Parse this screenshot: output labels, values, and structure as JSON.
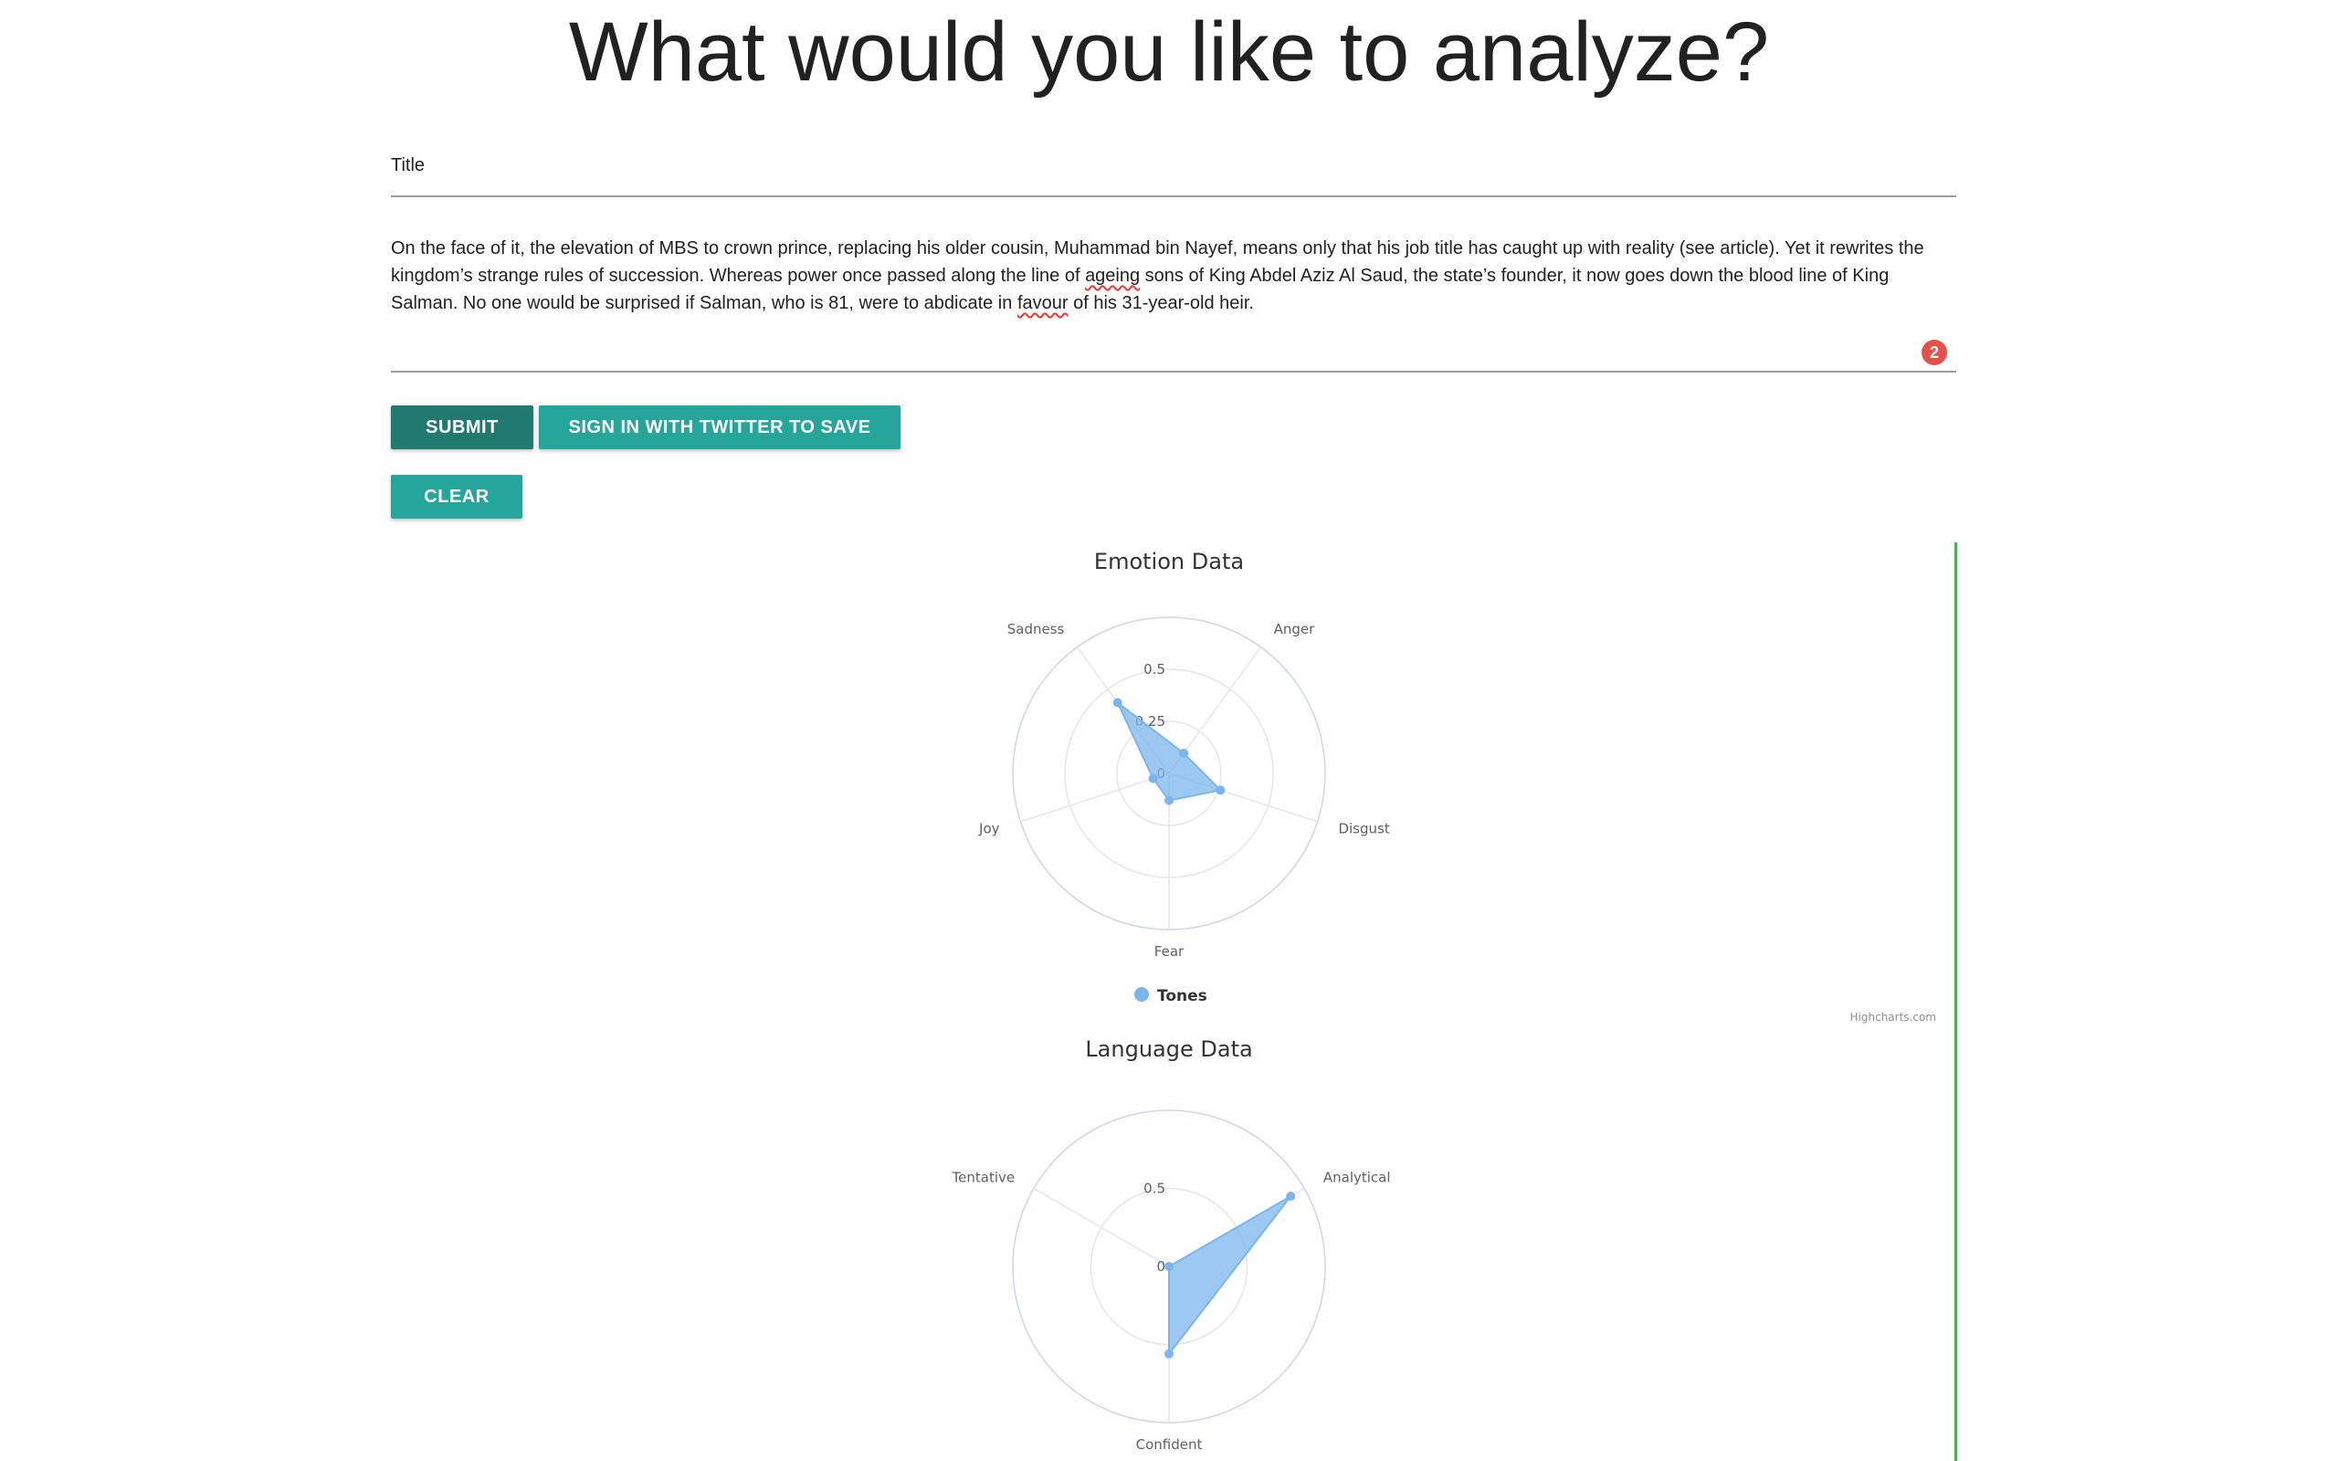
{
  "page": {
    "heading": "What would you like to analyze?"
  },
  "form": {
    "title_placeholder": "Title",
    "text_before_1": "On the face of it, the elevation of MBS to crown prince, replacing his older cousin, Muhammad bin Nayef, means only that his job title has caught up with reality (see article). Yet it rewrites the kingdom’s strange rules of succession. Whereas power once passed along the line of ",
    "text_spell_1": "ageing",
    "text_before_2": " sons of King Abdel Aziz Al Saud, the state’s founder, it now goes down the blood line of King Salman. No one would be surprised if Salman, who is 81, were to abdicate in ",
    "text_spell_2": "favour",
    "text_after": " of his 31-year-old heir.",
    "error_count": "2"
  },
  "buttons": {
    "submit": "SUBMIT",
    "twitter": "SIGN IN WITH TWITTER TO SAVE",
    "clear": "CLEAR"
  },
  "colors": {
    "series": "#7cb5ec",
    "accent": "#26a69a",
    "accent_dark": "#217a6f",
    "divider": "#4caf50",
    "badge": "#e2524a"
  },
  "credits": "Highcharts.com",
  "chart_data": [
    {
      "type": "radar",
      "title": "Emotion Data",
      "categories": [
        "Anger",
        "Disgust",
        "Fear",
        "Joy",
        "Sadness"
      ],
      "series": [
        {
          "name": "Tones",
          "values": [
            0.12,
            0.26,
            0.13,
            0.08,
            0.42
          ]
        }
      ],
      "ylim": [
        0,
        0.75
      ],
      "tick_values": [
        0,
        0.25,
        0.5
      ],
      "tick_labels": [
        "0",
        "0.25",
        "0.5"
      ],
      "legend": "bottom-center",
      "grid": true
    },
    {
      "type": "radar",
      "title": "Language Data",
      "categories": [
        "Analytical",
        "Confident",
        "Tentative"
      ],
      "series": [
        {
          "name": "Tones",
          "values": [
            0.9,
            0.56,
            0.0
          ]
        }
      ],
      "ylim": [
        0,
        1.0
      ],
      "tick_values": [
        0,
        0.5
      ],
      "tick_labels": [
        "0",
        "0.5"
      ],
      "legend": "none",
      "grid": true
    }
  ]
}
